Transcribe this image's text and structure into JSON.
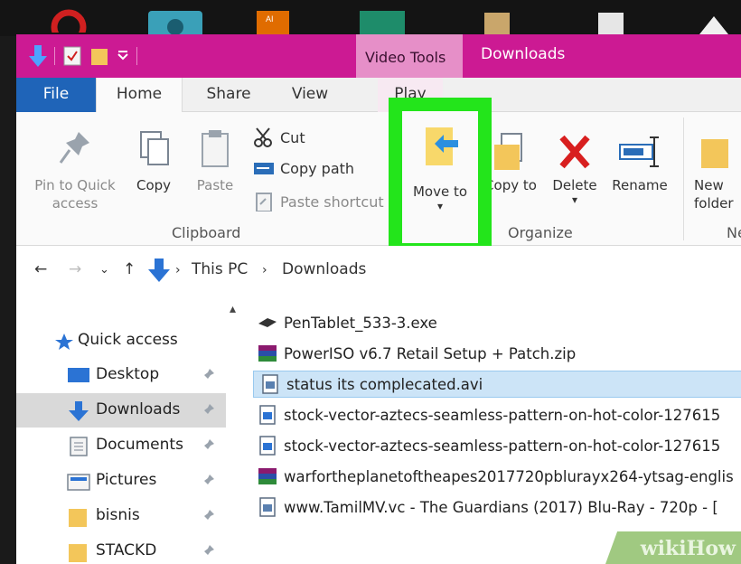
{
  "window": {
    "context_tab": "Video Tools",
    "title": "Downloads"
  },
  "ribbon_tabs": [
    "File",
    "Home",
    "Share",
    "View",
    "Play"
  ],
  "clipboard": {
    "pin_label": "Pin to Quick access",
    "copy_label": "Copy",
    "paste_label": "Paste",
    "cut_label": "Cut",
    "copy_path_label": "Copy path",
    "paste_shortcut_label": "Paste shortcut",
    "group_label": "Clipboard"
  },
  "organize": {
    "move_to_label": "Move to",
    "copy_to_label": "Copy to",
    "delete_label": "Delete",
    "rename_label": "Rename",
    "group_label": "Organize"
  },
  "new": {
    "new_folder_label": "New folder",
    "group_label": "New"
  },
  "address": {
    "crumbs": [
      "This PC",
      "Downloads"
    ]
  },
  "nav": {
    "items": [
      {
        "label": "Quick access"
      },
      {
        "label": "Desktop"
      },
      {
        "label": "Downloads"
      },
      {
        "label": "Documents"
      },
      {
        "label": "Pictures"
      },
      {
        "label": "bisnis"
      },
      {
        "label": "STACKD"
      }
    ]
  },
  "files": [
    {
      "name": "PenTablet_533-3.exe",
      "icon": "exe-icon"
    },
    {
      "name": "PowerISO v6.7 Retail Setup + Patch.zip",
      "icon": "winrar-icon"
    },
    {
      "name": "status its complecated.avi",
      "icon": "video-file-icon"
    },
    {
      "name": "stock-vector-aztecs-seamless-pattern-on-hot-color-127615",
      "icon": "image-file-icon"
    },
    {
      "name": "stock-vector-aztecs-seamless-pattern-on-hot-color-127615",
      "icon": "image-file-icon"
    },
    {
      "name": "warfortheplanetoftheapes2017720pblurayx264-ytsag-englis",
      "icon": "winrar-icon"
    },
    {
      "name": "www.TamilMV.vc - The Guardians (2017) Blu-Ray - 720p - [",
      "icon": "video-file-icon"
    }
  ],
  "watermark": "wikiHow",
  "colors": {
    "titlebar": "#cc1a93",
    "file_tab": "#1f64b8",
    "highlight": "#23e51b",
    "selection": "#cce4f7"
  }
}
